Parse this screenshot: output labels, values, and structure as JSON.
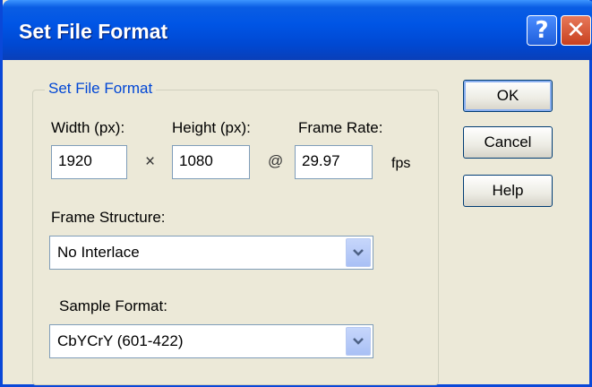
{
  "window": {
    "title": "Set File Format",
    "help_glyph": "?",
    "close_glyph": "✕"
  },
  "group": {
    "title": "Set File Format"
  },
  "fields": {
    "width_label": "Width (px):",
    "width_value": "1920",
    "height_label": "Height (px):",
    "height_value": "1080",
    "frame_rate_label": "Frame Rate:",
    "frame_rate_value": "29.97",
    "times_glyph": "×",
    "at_glyph": "@",
    "fps_unit": "fps"
  },
  "frame_structure": {
    "label": "Frame Structure:",
    "selected": "No Interlace"
  },
  "sample_format": {
    "label": "Sample Format:",
    "selected": "CbYCrY (601-422)"
  },
  "buttons": {
    "ok": "OK",
    "cancel": "Cancel",
    "help": "Help"
  },
  "colors": {
    "titlebar": "#0055e5",
    "group_title": "#0046d5",
    "dialog_bg": "#ece9d8"
  }
}
